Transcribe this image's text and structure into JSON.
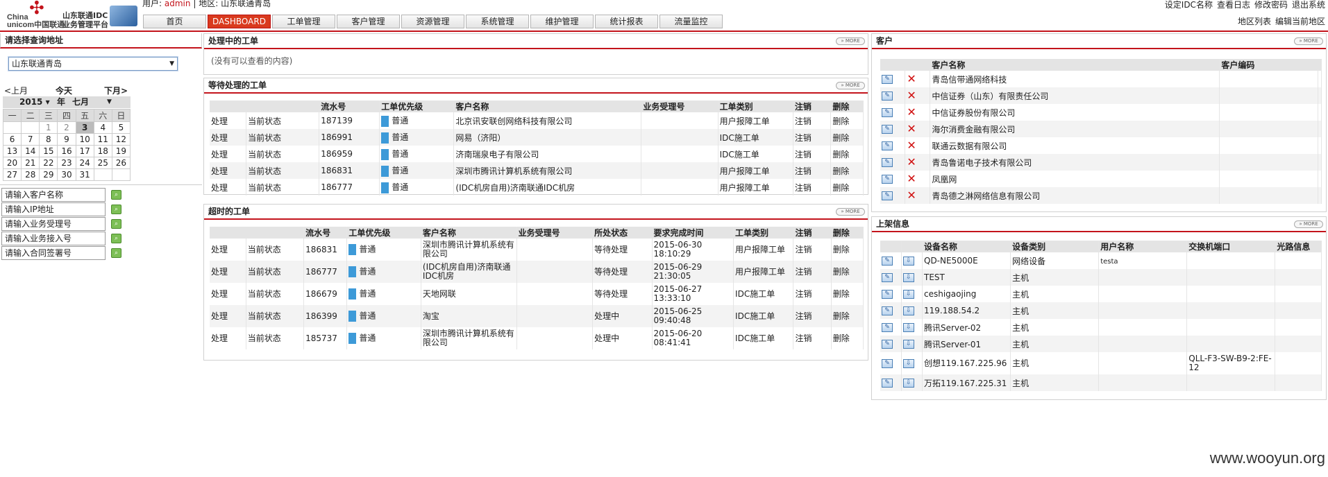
{
  "logo": {
    "knot": "✣",
    "china": "China\nunicom中国联通",
    "sub1": "山东联通IDC",
    "sub2": "业务管理平台"
  },
  "user": {
    "label": "用户:",
    "name": "admin",
    "sep": "|",
    "region_label": "地区:",
    "region": "山东联通青岛"
  },
  "top_links": [
    "设定IDC名称",
    "查看日志",
    "修改密码",
    "退出系统"
  ],
  "sub_links": [
    "地区列表",
    "编辑当前地区"
  ],
  "nav": [
    "首页",
    "DASHBOARD",
    "工单管理",
    "客户管理",
    "资源管理",
    "系统管理",
    "维护管理",
    "统计报表",
    "流量监控"
  ],
  "left": {
    "title": "请选择查询地址",
    "select_value": "山东联通青岛",
    "cal": {
      "prev": "<上月",
      "today": "今天",
      "next": "下月>",
      "year": "2015",
      "year_suffix": "年",
      "month": "七月",
      "weekdays": [
        "一",
        "二",
        "三",
        "四",
        "五",
        "六",
        "日"
      ],
      "weeks": [
        [
          "",
          "",
          "1",
          "2",
          "3",
          "4",
          "5"
        ],
        [
          "6",
          "7",
          "8",
          "9",
          "10",
          "11",
          "12"
        ],
        [
          "13",
          "14",
          "15",
          "16",
          "17",
          "18",
          "19"
        ],
        [
          "20",
          "21",
          "22",
          "23",
          "24",
          "25",
          "26"
        ],
        [
          "27",
          "28",
          "29",
          "30",
          "31",
          "",
          ""
        ]
      ]
    },
    "search": [
      "请输入客户名称",
      "请输入IP地址",
      "请输入业务受理号",
      "请输入业务接入号",
      "请输入合同签署号"
    ]
  },
  "processing": {
    "title": "处理中的工单",
    "more": "» MORE",
    "empty": "(没有可以查看的内容)"
  },
  "pending": {
    "title": "等待处理的工单",
    "more": "» MORE",
    "headers": [
      "",
      "",
      "流水号",
      "工单优先级",
      "客户名称",
      "业务受理号",
      "工单类别",
      "注销",
      "删除"
    ],
    "rows": [
      [
        "处理",
        "当前状态",
        "187139",
        "普通",
        "北京讯安联创网络科技有限公司",
        "",
        "用户报障工单",
        "注销",
        "删除"
      ],
      [
        "处理",
        "当前状态",
        "186991",
        "普通",
        "网易（济阳）",
        "",
        "IDC施工单",
        "注销",
        "删除"
      ],
      [
        "处理",
        "当前状态",
        "186959",
        "普通",
        "济南瑞泉电子有限公司",
        "",
        "IDC施工单",
        "注销",
        "删除"
      ],
      [
        "处理",
        "当前状态",
        "186831",
        "普通",
        "深圳市腾讯计算机系统有限公司",
        "",
        "用户报障工单",
        "注销",
        "删除"
      ],
      [
        "处理",
        "当前状态",
        "186777",
        "普通",
        "(IDC机房自用)济南联通IDC机房",
        "",
        "用户报障工单",
        "注销",
        "删除"
      ]
    ]
  },
  "overdue": {
    "title": "超时的工单",
    "more": "» MORE",
    "headers": [
      "",
      "",
      "流水号",
      "工单优先级",
      "客户名称",
      "业务受理号",
      "所处状态",
      "要求完成时间",
      "工单类别",
      "注销",
      "删除"
    ],
    "rows": [
      [
        "处理",
        "当前状态",
        "186831",
        "普通",
        "深圳市腾讯计算机系统有限公司",
        "",
        "等待处理",
        "2015-06-30 18:10:29",
        "用户报障工单",
        "注销",
        "删除"
      ],
      [
        "处理",
        "当前状态",
        "186777",
        "普通",
        "(IDC机房自用)济南联通IDC机房",
        "",
        "等待处理",
        "2015-06-29 21:30:05",
        "用户报障工单",
        "注销",
        "删除"
      ],
      [
        "处理",
        "当前状态",
        "186679",
        "普通",
        "天地网联",
        "",
        "等待处理",
        "2015-06-27 13:33:10",
        "IDC施工单",
        "注销",
        "删除"
      ],
      [
        "处理",
        "当前状态",
        "186399",
        "普通",
        "淘宝",
        "",
        "处理中",
        "2015-06-25 09:40:48",
        "IDC施工单",
        "注销",
        "删除"
      ],
      [
        "处理",
        "当前状态",
        "185737",
        "普通",
        "深圳市腾讯计算机系统有限公司",
        "",
        "处理中",
        "2015-06-20 08:41:41",
        "IDC施工单",
        "注销",
        "删除"
      ]
    ]
  },
  "customers": {
    "title": "客户",
    "more": "» MORE",
    "headers": [
      "",
      "",
      "客户名称",
      "客户编码",
      ""
    ],
    "rows": [
      "青岛信带通网络科技",
      "中信证券（山东）有限责任公司",
      "中信证券股份有限公司",
      "海尔消费金融有限公司",
      "联通云数据有限公司",
      "青岛鲁诺电子技术有限公司",
      "凤凰网",
      "青岛德之淋网络信息有限公司"
    ]
  },
  "devices": {
    "title": "上架信息",
    "more": "» MORE",
    "headers": [
      "",
      "",
      "设备名称",
      "设备类别",
      "用户名称",
      "交换机端口",
      "光路信息"
    ],
    "rows": [
      [
        "QD-NE5000E",
        "网络设备",
        "testa",
        ""
      ],
      [
        "TEST",
        "主机",
        "",
        ""
      ],
      [
        "ceshigaojing",
        "主机",
        "",
        ""
      ],
      [
        "119.188.54.2",
        "主机",
        "",
        ""
      ],
      [
        "腾讯Server-02",
        "主机",
        "",
        ""
      ],
      [
        "腾讯Server-01",
        "主机",
        "",
        ""
      ],
      [
        "创想119.167.225.96",
        "主机",
        "",
        "QLL-F3-SW-B9-2:FE-12"
      ],
      [
        "万拓119.167.225.31",
        "主机",
        "",
        ""
      ]
    ]
  },
  "watermark": "www.wooyun.org"
}
